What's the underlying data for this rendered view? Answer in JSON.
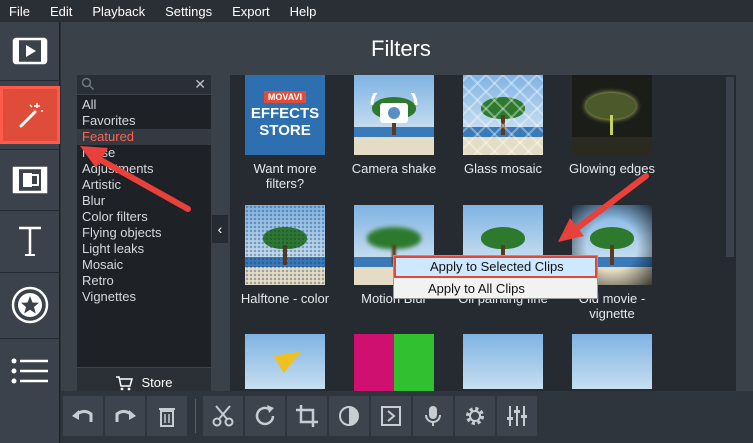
{
  "menu": {
    "file": "File",
    "edit": "Edit",
    "playback": "Playback",
    "settings": "Settings",
    "export": "Export",
    "help": "Help"
  },
  "panel": {
    "title": "Filters"
  },
  "search": {
    "placeholder": "",
    "clear": "✕"
  },
  "categories": [
    {
      "label": "All"
    },
    {
      "label": "Favorites"
    },
    {
      "label": "Featured"
    },
    {
      "label": "Noise"
    },
    {
      "label": "Adjustments"
    },
    {
      "label": "Artistic"
    },
    {
      "label": "Blur"
    },
    {
      "label": "Color filters"
    },
    {
      "label": "Flying objects"
    },
    {
      "label": "Light leaks"
    },
    {
      "label": "Mosaic"
    },
    {
      "label": "Retro"
    },
    {
      "label": "Vignettes"
    }
  ],
  "store_button": "Store",
  "collapse_glyph": "‹",
  "filters": [
    {
      "label": "Want more filters?",
      "thumb": "store-thumbnail",
      "store_lines": [
        "MOVAVI",
        "EFFECTS",
        "STORE"
      ]
    },
    {
      "label": "Camera shake",
      "thumb": "camera-thumbnail"
    },
    {
      "label": "Glass mosaic",
      "thumb": "glass-mosaic-thumbnail"
    },
    {
      "label": "Glowing edges",
      "thumb": "glowing-edges-thumbnail"
    },
    {
      "label": "Halftone - color",
      "thumb": "halftone-thumbnail"
    },
    {
      "label": "Motion Blur",
      "thumb": "motion-blur-thumbnail"
    },
    {
      "label": "Oil painting fine",
      "thumb": "oil-painting-thumbnail"
    },
    {
      "label": "Old movie - vignette",
      "thumb": "old-movie-thumbnail"
    }
  ],
  "context_menu": {
    "apply_selected": "Apply to Selected Clips",
    "apply_all": "Apply to All Clips"
  },
  "colors": {
    "accent": "#e04c3a",
    "highlight_text": "#ff6450",
    "annotation_arrow": "#e8403a",
    "menu_highlight": "#cde8ff"
  },
  "sidebar_tools": [
    "import-icon",
    "filters-wand-icon",
    "transitions-icon",
    "titles-icon",
    "stickers-star-icon",
    "menu-list-icon"
  ],
  "toolbar_tools": [
    "undo-icon",
    "redo-icon",
    "delete-icon",
    "cut-icon",
    "rotate-icon",
    "crop-icon",
    "color-adjust-icon",
    "clip-properties-icon",
    "record-audio-icon",
    "settings-gear-icon",
    "equalizer-icon"
  ]
}
